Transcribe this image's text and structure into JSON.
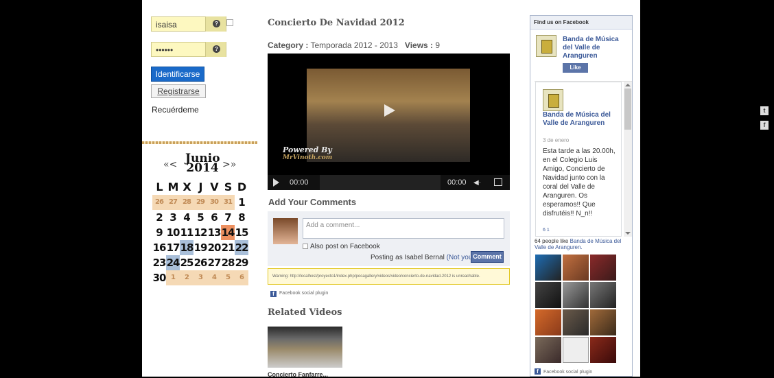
{
  "login": {
    "username_value": "isaisa",
    "password_value": "••••••",
    "hint_icon": "question-icon",
    "login_button": "Identificarse",
    "register_button": "Registrarse",
    "remember_label": "Recuérdeme"
  },
  "calendar": {
    "prev": "«<",
    "month": "Junio",
    "year": "2014",
    "next": ">»",
    "weekdays": [
      "L",
      "M",
      "X",
      "J",
      "V",
      "S",
      "D"
    ],
    "weeks": [
      [
        "26",
        "27",
        "28",
        "29",
        "30",
        "31",
        "1"
      ],
      [
        "2",
        "3",
        "4",
        "5",
        "6",
        "7",
        "8"
      ],
      [
        "9",
        "10",
        "11",
        "12",
        "13",
        "14",
        "15"
      ],
      [
        "16",
        "17",
        "18",
        "19",
        "20",
        "21",
        "22"
      ],
      [
        "23",
        "24",
        "25",
        "26",
        "27",
        "28",
        "29"
      ],
      [
        "30",
        "1",
        "2",
        "3",
        "4",
        "5",
        "6"
      ]
    ]
  },
  "video": {
    "title": "Concierto De Navidad 2012",
    "category_label": "Category :",
    "category_value": "Temporada 2012 - 2013",
    "views_label": "Views :",
    "views_value": "9",
    "powered_by": "Powered By",
    "powered_url": "MrVinoth.com",
    "time_current": "00:00",
    "time_total": "00:00"
  },
  "comments": {
    "heading": "Add Your Comments",
    "placeholder": "Add a comment...",
    "also_post": "Also post on Facebook",
    "posting_as": "Posting as Isabel Bernal",
    "not_you": "(Not you?)",
    "comment_button": "Comment",
    "warning": "Warning: http://localhost/proyecto1/index.php/pocagallery/videos/video/concierto-de-navidad-2012 is unreachable.",
    "plugin_label": "Facebook social plugin"
  },
  "related": {
    "heading": "Related Videos",
    "items": [
      {
        "caption": "Concierto Fanfarre..."
      }
    ]
  },
  "facebook_box": {
    "header": "Find us on Facebook",
    "page_name": "Banda de Música del Valle de Aranguren",
    "like_label": "Like",
    "post": {
      "author": "Banda de Música del Valle de Aranguren",
      "date": "3 de enero",
      "text": "Esta tarde a las 20.00h, en el Colegio Luis Amigo, Concierto de Navidad junto con la coral del Valle de Aranguren. Os esperamos!! Que disfrutéis!! N_n!!",
      "reactions": "6   1"
    },
    "fans_count_text": "64 people like",
    "fans_page_link": "Banda de Música del Valle de Aranguren.",
    "plugin_label": "Facebook social plugin"
  },
  "share": {
    "twitter": "t",
    "facebook": "f"
  },
  "colors": {
    "facebook_blue": "#3b5998",
    "login_button": "#1a6ac9",
    "calendar_other_month": "#f5d9b5",
    "calendar_highlight_orange": "#ed9060",
    "calendar_highlight_blue": "#a9bfd9",
    "input_yellow": "#fdf8c0"
  }
}
